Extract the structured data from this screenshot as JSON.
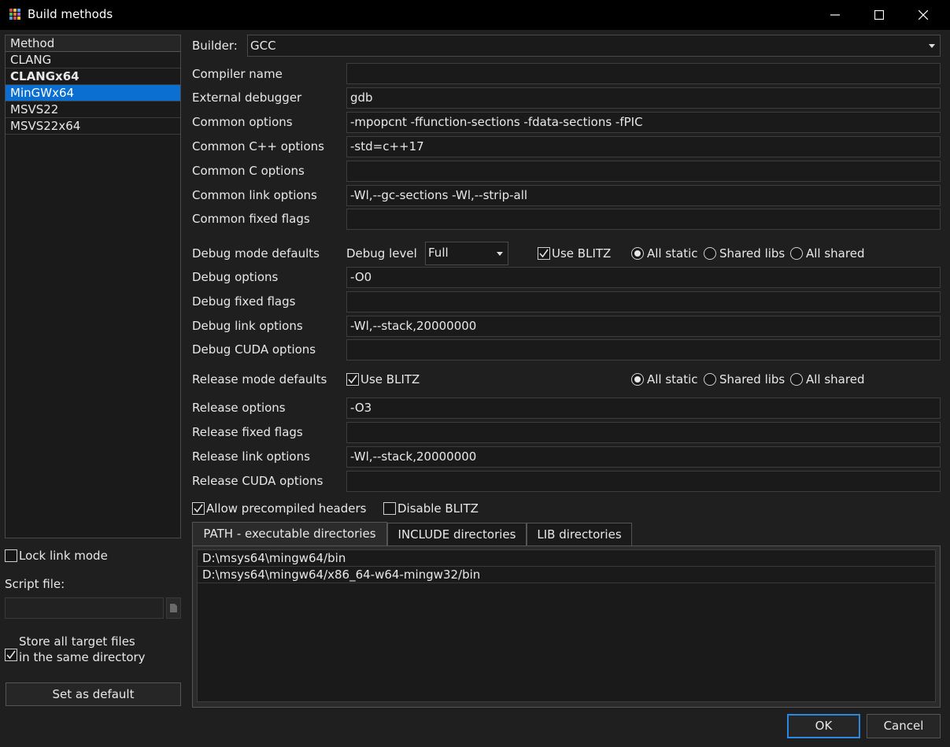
{
  "window": {
    "title": "Build methods",
    "icon": "app-grid-icon",
    "controls": [
      "minimize-icon",
      "maximize-icon",
      "close-icon"
    ]
  },
  "method_list": {
    "header": "Method",
    "items": [
      {
        "label": "CLANG",
        "bold": false,
        "selected": false
      },
      {
        "label": "CLANGx64",
        "bold": true,
        "selected": false
      },
      {
        "label": "MinGWx64",
        "bold": false,
        "selected": true
      },
      {
        "label": "MSVS22",
        "bold": false,
        "selected": false
      },
      {
        "label": "MSVS22x64",
        "bold": false,
        "selected": false
      }
    ]
  },
  "left_panel": {
    "lock_link_mode": {
      "label": "Lock link mode",
      "checked": false
    },
    "script_file": {
      "label": "Script file:",
      "value": ""
    },
    "store_targets": {
      "line1": "Store all target files",
      "line2": "in the same directory",
      "checked": true
    },
    "set_default": "Set as default"
  },
  "builder": {
    "label": "Builder:",
    "value": "GCC"
  },
  "fields": {
    "compiler_name": {
      "label": "Compiler name",
      "value": ""
    },
    "external_debugger": {
      "label": "External debugger",
      "value": "gdb"
    },
    "common_options": {
      "label": "Common options",
      "value": "-mpopcnt -ffunction-sections -fdata-sections -fPIC"
    },
    "common_cpp_options": {
      "label": "Common C++ options",
      "value": "-std=c++17"
    },
    "common_c_options": {
      "label": "Common C options",
      "value": ""
    },
    "common_link_options": {
      "label": "Common link options",
      "value": "-Wl,--gc-sections -Wl,--strip-all"
    },
    "common_fixed_flags": {
      "label": "Common fixed flags",
      "value": ""
    },
    "debug_options": {
      "label": "Debug options",
      "value": "-O0"
    },
    "debug_fixed_flags": {
      "label": "Debug fixed flags",
      "value": ""
    },
    "debug_link_options": {
      "label": "Debug link options",
      "value": "-Wl,--stack,20000000"
    },
    "debug_cuda_options": {
      "label": "Debug CUDA options",
      "value": ""
    },
    "release_options": {
      "label": "Release options",
      "value": "-O3"
    },
    "release_fixed_flags": {
      "label": "Release fixed flags",
      "value": ""
    },
    "release_link_options": {
      "label": "Release link options",
      "value": "-Wl,--stack,20000000"
    },
    "release_cuda_options": {
      "label": "Release CUDA options",
      "value": ""
    }
  },
  "debug_defaults": {
    "label": "Debug mode defaults",
    "level_label": "Debug level",
    "level_value": "Full",
    "use_blitz": {
      "label": "Use BLITZ",
      "checked": true
    },
    "linkage": {
      "selected": "All static",
      "options": [
        "All static",
        "Shared libs",
        "All shared"
      ]
    }
  },
  "release_defaults": {
    "label": "Release mode defaults",
    "use_blitz": {
      "label": "Use BLITZ",
      "checked": true
    },
    "linkage": {
      "selected": "All static",
      "options": [
        "All static",
        "Shared libs",
        "All shared"
      ]
    }
  },
  "flags": {
    "precompiled_headers": {
      "label": "Allow precompiled headers",
      "checked": true
    },
    "disable_blitz": {
      "label": "Disable BLITZ",
      "checked": false
    }
  },
  "tabs": [
    {
      "label": "PATH - executable directories",
      "active": true
    },
    {
      "label": "INCLUDE directories",
      "active": false
    },
    {
      "label": "LIB directories",
      "active": false
    }
  ],
  "path_entries": [
    "D:\\msys64\\mingw64/bin",
    "D:\\msys64\\mingw64/x86_64-w64-mingw32/bin"
  ],
  "buttons": {
    "ok": "OK",
    "cancel": "Cancel"
  },
  "colors": {
    "selection": "#0a6fd0",
    "ok_border": "#2b87e0",
    "titlebar": "#000000",
    "background": "#1f1f1f"
  }
}
